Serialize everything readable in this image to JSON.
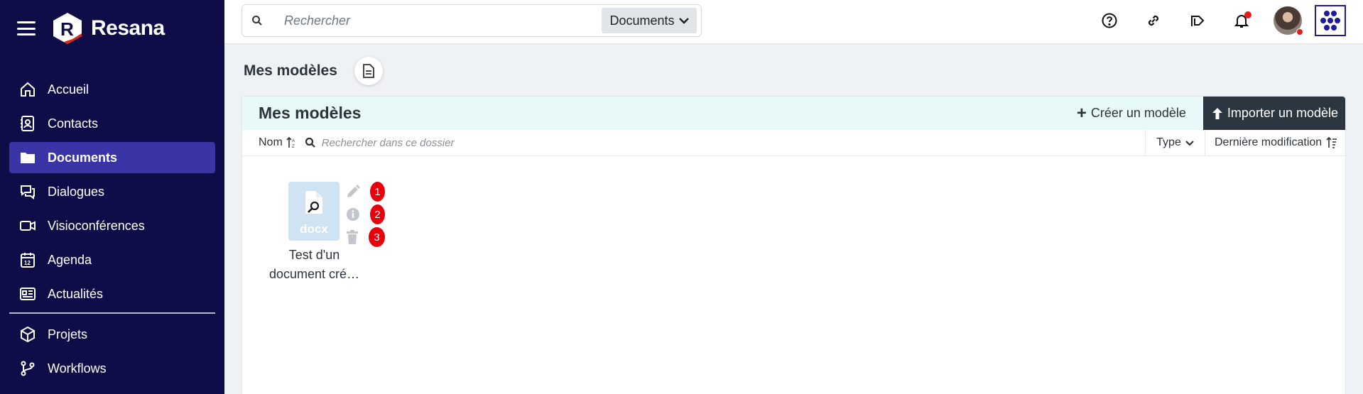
{
  "app": {
    "name": "Resana"
  },
  "sidebar": {
    "items": [
      {
        "label": "Accueil",
        "icon": "home-icon"
      },
      {
        "label": "Contacts",
        "icon": "contacts-icon"
      },
      {
        "label": "Documents",
        "icon": "folder-icon",
        "active": true
      },
      {
        "label": "Dialogues",
        "icon": "chat-icon"
      },
      {
        "label": "Visioconférences",
        "icon": "video-icon"
      },
      {
        "label": "Agenda",
        "icon": "calendar-icon"
      },
      {
        "label": "Actualités",
        "icon": "news-icon"
      }
    ],
    "items2": [
      {
        "label": "Projets",
        "icon": "cube-icon"
      },
      {
        "label": "Workflows",
        "icon": "workflow-icon"
      }
    ]
  },
  "search": {
    "placeholder": "Rechercher",
    "scope": "Documents"
  },
  "page": {
    "title": "Mes modèles"
  },
  "panel": {
    "title": "Mes modèles",
    "create_label": "Créer un modèle",
    "import_label": "Importer un modèle",
    "columns": {
      "name": "Nom",
      "search_placeholder": "Rechercher dans ce dossier",
      "type": "Type",
      "modified": "Dernière modification"
    }
  },
  "files": [
    {
      "ext": "docx",
      "name_line1": "Test d'un",
      "name_line2": "document cré…",
      "actions": [
        "1",
        "2",
        "3"
      ]
    }
  ],
  "colors": {
    "sidebar_bg": "#0f0d47",
    "active_item": "#3a34a6",
    "import_btn": "#2b3640",
    "badge": "#e8000b"
  }
}
